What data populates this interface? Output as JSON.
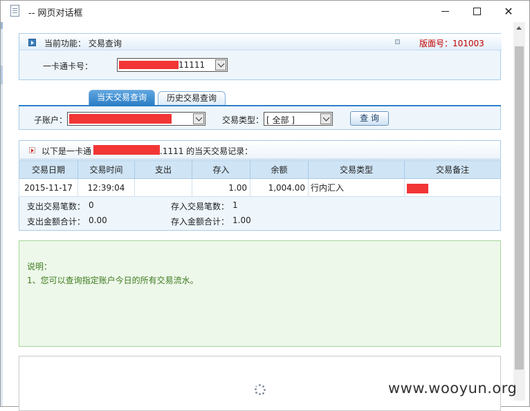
{
  "window": {
    "title": "-- 网页对话框",
    "minimize_icon": "minimize-icon",
    "maximize_icon": "maximize-icon",
    "close_icon": "close-icon",
    "close_glyph": "✕"
  },
  "header": {
    "function_label": "当前功能： 交易查询",
    "version_label": "版面号：101003"
  },
  "card": {
    "label": "一卡通卡号：",
    "value_suffix": "11111"
  },
  "tabs": [
    {
      "label": "当天交易查询",
      "active": true
    },
    {
      "label": "历史交易查询",
      "active": false
    }
  ],
  "filter": {
    "sub_account_label": "子账户：",
    "trade_type_label": "交易类型：",
    "trade_type_value": "[ 全部 ]",
    "query_button": "查 询"
  },
  "records": {
    "prefix": "以下是一卡通",
    "suffix": ".1111 的当天交易记录："
  },
  "table": {
    "columns": [
      "交易日期",
      "交易时间",
      "支出",
      "存入",
      "余额",
      "交易类型",
      "交易备注"
    ],
    "rows": [
      {
        "date": "2015-11-17",
        "time": "12:39:04",
        "out": "",
        "in": "1.00",
        "balance": "1,004.00",
        "type": "行内汇入",
        "note": ""
      }
    ]
  },
  "summary": {
    "out_count_label": "支出交易笔数：",
    "out_count": "0",
    "in_count_label": "存入交易笔数：",
    "in_count": "1",
    "out_total_label": "支出金额合计：",
    "out_total": "0.00",
    "in_total_label": "存入金额合计：",
    "in_total": "1.00"
  },
  "note": {
    "title": "说明：",
    "line1": "1、您可以查询指定账户今日的所有交易流水。"
  },
  "watermark": "www.wooyun.org",
  "colors": {
    "accent": "#2d7fc6",
    "redaction": "#f23535",
    "version_red": "#c00000",
    "note_green": "#3d7a1f"
  }
}
